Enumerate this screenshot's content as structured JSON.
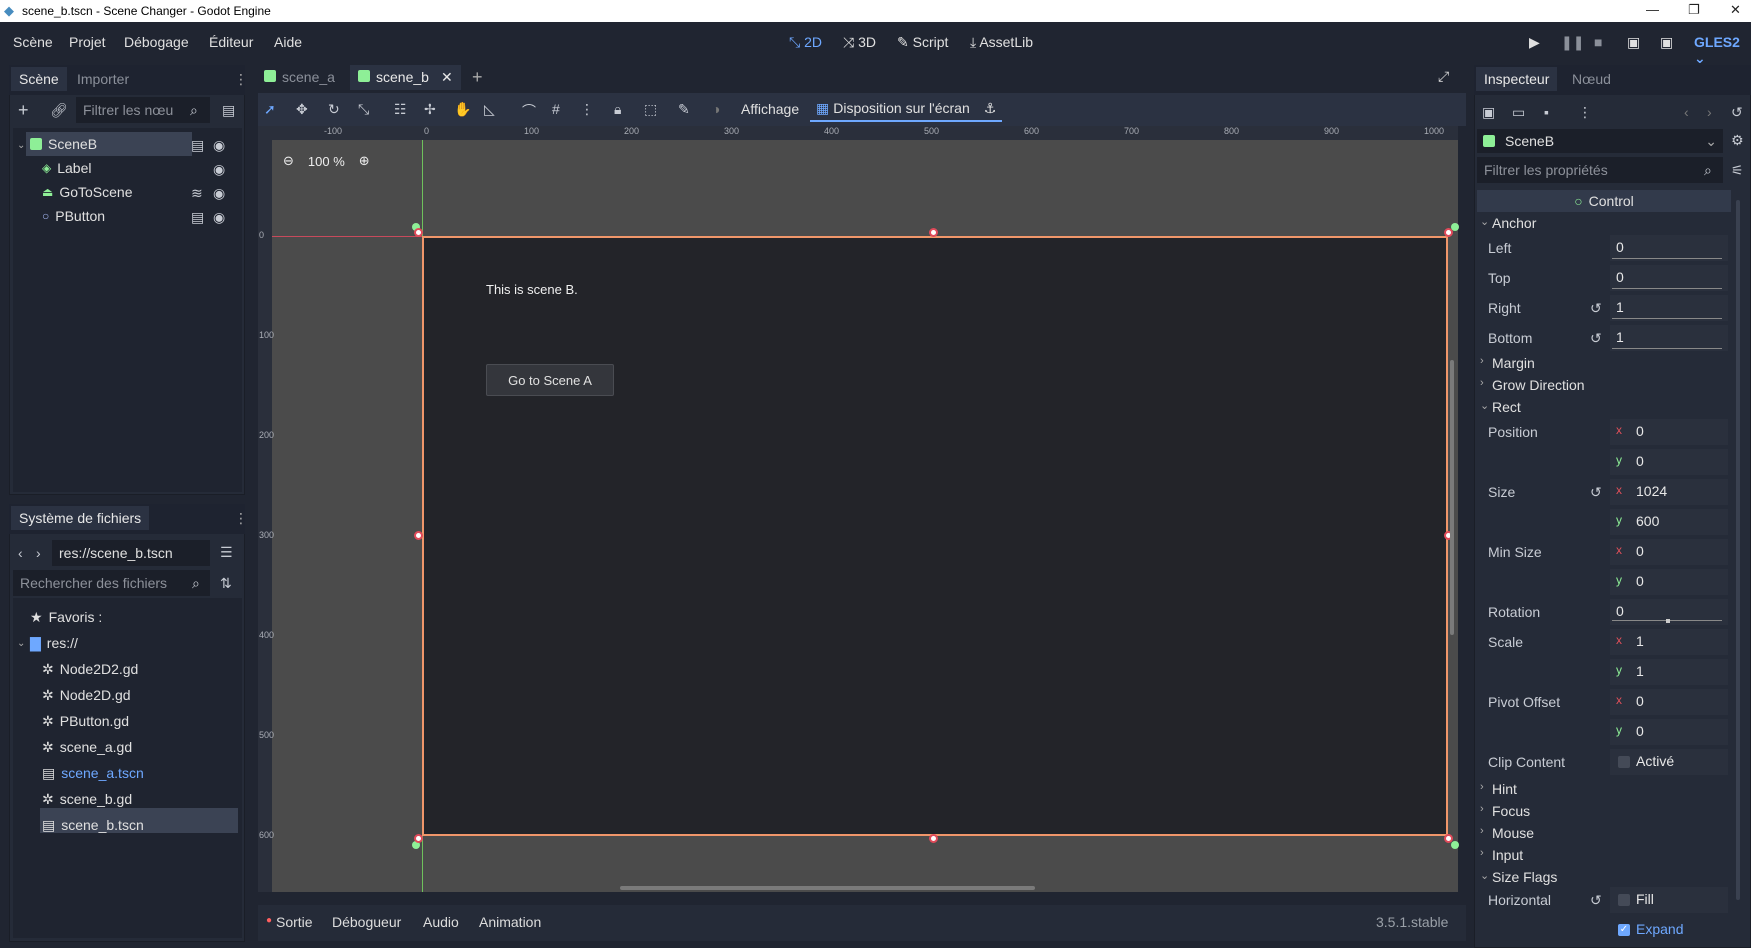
{
  "window": {
    "title": "scene_b.tscn - Scene Changer - Godot Engine"
  },
  "menu": [
    "Scène",
    "Projet",
    "Débogage",
    "Éditeur",
    "Aide"
  ],
  "workspaces": [
    "2D",
    "3D",
    "Script",
    "AssetLib"
  ],
  "renderer": "GLES2",
  "scene_dock": {
    "tabs": [
      "Scène",
      "Importer"
    ],
    "filter_placeholder": "Filtrer les nœu",
    "nodes": [
      "SceneB",
      "Label",
      "GoToScene",
      "PButton"
    ]
  },
  "filesystem": {
    "tab": "Système de fichiers",
    "path": "res://scene_b.tscn",
    "search_placeholder": "Rechercher des fichiers",
    "favorites": "Favoris :",
    "root": "res://",
    "files": [
      "Node2D2.gd",
      "Node2D.gd",
      "PButton.gd",
      "scene_a.gd",
      "scene_a.tscn",
      "scene_b.gd",
      "scene_b.tscn"
    ]
  },
  "editor_tabs": [
    "scene_a",
    "scene_b"
  ],
  "toolbar": {
    "affichage": "Affichage",
    "disposition": "Disposition sur l'écran"
  },
  "viewport": {
    "zoom": "100 %",
    "label_text": "This is scene B.",
    "button_text": "Go to Scene A",
    "ruler_h": [
      "-100",
      "0",
      "100",
      "200",
      "300",
      "400",
      "500",
      "600",
      "700",
      "800",
      "900",
      "1000"
    ],
    "ruler_v": [
      "0",
      "100",
      "200",
      "300",
      "400",
      "500",
      "600"
    ]
  },
  "bottom": {
    "tabs": [
      "Sortie",
      "Débogueur",
      "Audio",
      "Animation"
    ],
    "version": "3.5.1.stable"
  },
  "inspector": {
    "tabs": [
      "Inspecteur",
      "Nœud"
    ],
    "node": "SceneB",
    "filter_placeholder": "Filtrer les propriétés",
    "class": "Control",
    "anchor": {
      "title": "Anchor",
      "left": "0",
      "top": "0",
      "right": "1",
      "bottom": "1"
    },
    "labels": {
      "left": "Left",
      "top": "Top",
      "right": "Right",
      "bottom": "Bottom"
    },
    "margin": "Margin",
    "grow": "Grow Direction",
    "rect": "Rect",
    "position": {
      "label": "Position",
      "x": "0",
      "y": "0"
    },
    "size": {
      "label": "Size",
      "x": "1024",
      "y": "600"
    },
    "min_size": {
      "label": "Min Size",
      "x": "0",
      "y": "0"
    },
    "rotation": {
      "label": "Rotation",
      "value": "0"
    },
    "scale": {
      "label": "Scale",
      "x": "1",
      "y": "1"
    },
    "pivot": {
      "label": "Pivot Offset",
      "x": "0",
      "y": "0"
    },
    "clip": {
      "label": "Clip Content",
      "value": "Activé"
    },
    "sections": [
      "Hint",
      "Focus",
      "Mouse",
      "Input",
      "Size Flags"
    ],
    "horizontal": {
      "label": "Horizontal",
      "fill": "Fill",
      "expand": "Expand"
    }
  }
}
